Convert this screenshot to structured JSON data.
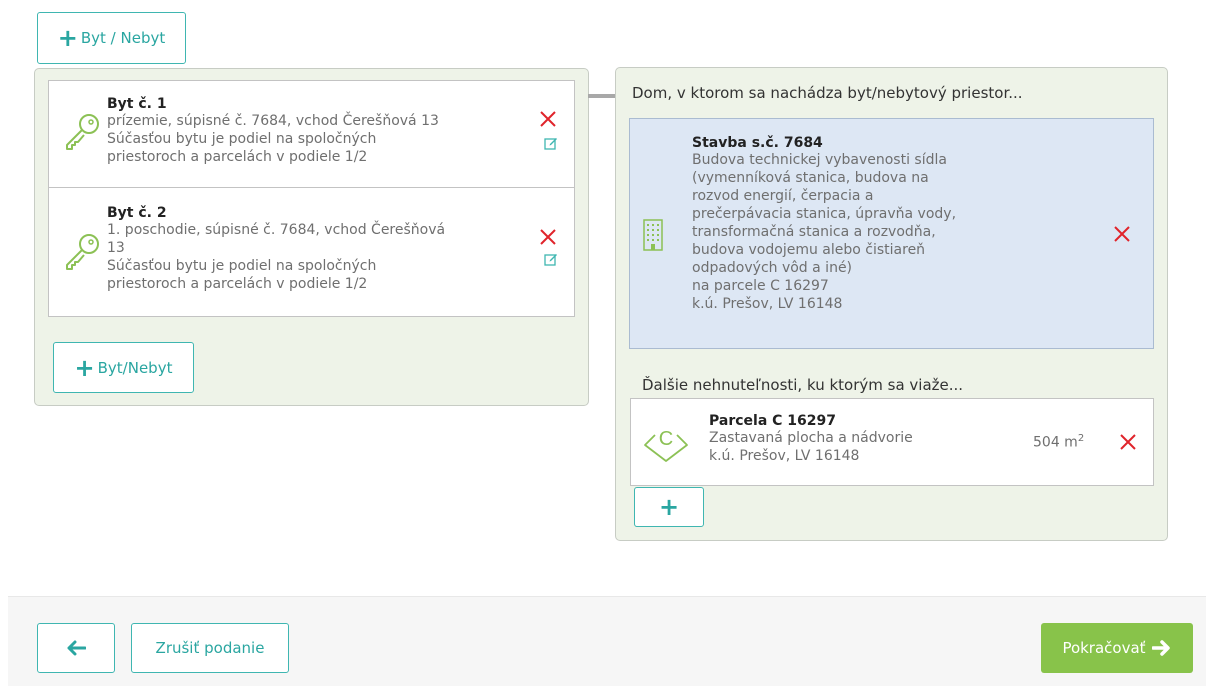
{
  "top_add_button": {
    "label": "Byt / Nebyt"
  },
  "units_panel": {
    "units": [
      {
        "title": "Byt č. 1",
        "lines": [
          "prízemie, súpisné č. 7684, vchod Čerešňová 13",
          "Súčasťou bytu je podiel na spoločných",
          "priestoroch a parcelách v podiele 1/2"
        ]
      },
      {
        "title": "Byt č. 2",
        "lines": [
          "1. poschodie, súpisné č. 7684, vchod Čerešňová",
          "13",
          "Súčasťou bytu je podiel na spoločných",
          "priestoroch a parcelách v podiele 1/2"
        ]
      }
    ],
    "add_button_label": "Byt/Nebyt"
  },
  "building_panel": {
    "heading": "Dom, v ktorom sa nachádza byt/nebytový priestor...",
    "building": {
      "title": "Stavba s.č. 7684",
      "lines": [
        "Budova technickej vybavenosti sídla",
        "(vymenníková stanica, budova na",
        "rozvod energií, čerpacia a",
        "prečerpávacia stanica, úpravňa vody,",
        "transformačná stanica a rozvodňa,",
        "budova vodojemu alebo čistiareň",
        "odpadových vôd a iné)",
        "na parcele C 16297",
        "k.ú. Prešov, LV 16148"
      ]
    },
    "related_heading": "Ďalšie nehnuteľnosti, ku ktorým sa viaže...",
    "parcel": {
      "title": "Parcela C 16297",
      "lines": [
        "Zastavaná plocha a nádvorie",
        "k.ú. Prešov, LV 16148"
      ],
      "area": "504 m",
      "area_sup": "2"
    },
    "add_button_label": "+"
  },
  "footer": {
    "back_icon": "arrow-left-icon",
    "cancel_label": "Zrušiť podanie",
    "continue_label": "Pokračovať"
  },
  "colors": {
    "teal": "#2aa6a1",
    "green": "#88c34a",
    "red": "#e0242b",
    "panel_bg": "#eef3e8",
    "building_bg": "#dde7f4"
  }
}
